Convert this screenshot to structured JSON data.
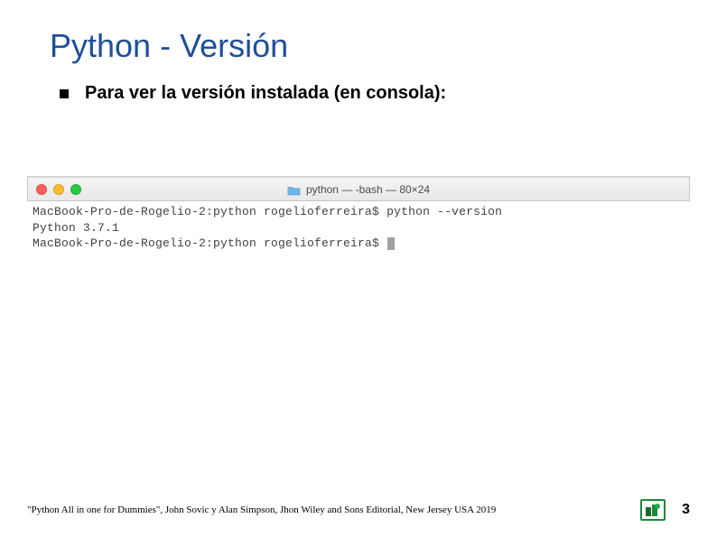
{
  "title": "Python - Versión",
  "bullet": "Para ver la versión instalada (en consola):",
  "terminal": {
    "title_text": "python — -bash — 80×24",
    "lines": {
      "l1_prompt": "MacBook-Pro-de-Rogelio-2:python rogelioferreira$ ",
      "l1_cmd": "python --version",
      "l2": "Python 3.7.1",
      "l3_prompt": "MacBook-Pro-de-Rogelio-2:python rogelioferreira$ "
    }
  },
  "citation": "\"Python All in one for Dummies\", John Sovic y Alan Simpson, Jhon Wiley and Sons Editorial, New Jersey USA 2019",
  "page_number": "3"
}
